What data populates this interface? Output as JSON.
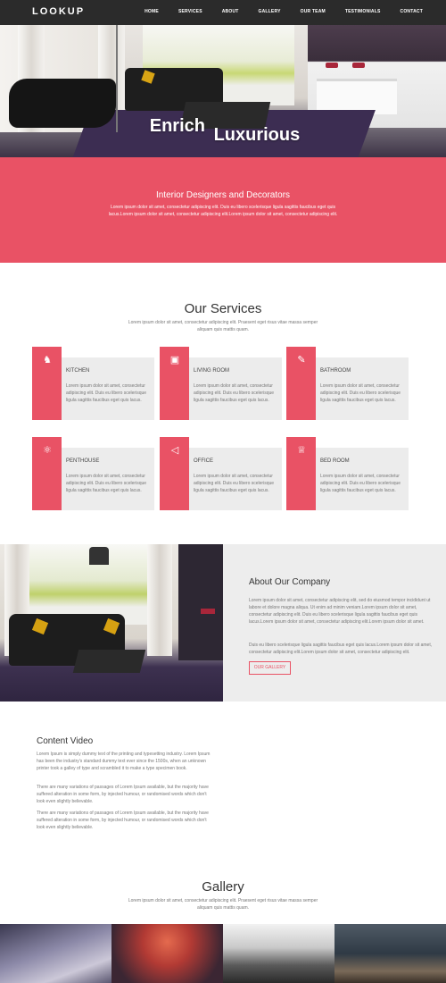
{
  "nav": {
    "logo": "LOOKUP",
    "items": [
      "HOME",
      "SERVICES",
      "ABOUT",
      "GALLERY",
      "OUR TEAM",
      "TESTIMONIALS",
      "CONTACT"
    ]
  },
  "hero": {
    "title_word1": "Enrich",
    "title_word2": "Luxurious"
  },
  "band": {
    "title": "Interior Designers and Decorators",
    "text": "Lorem ipsum dolor sit amet, consectetur adipiscing elit. Duis eu libero scelerisque ligula sagittis faucibus eget quis lacus.Lorem ipsum dolor sit amet, consectetur adipiscing elit.Lorem ipsum dolor sit amet, consectetur adipiscing elit."
  },
  "services": {
    "title": "Our Services",
    "subtitle": "Lorem ipsum dolor sit amet, consectetur adipiscing elit. Praesent eget risus vitae massa semper aliquam quis mattis quam.",
    "cards": [
      {
        "title": "KITCHEN",
        "icon": "chess-knight-icon",
        "glyph": "♞",
        "text": "Lorem ipsum dolor sit amet, consectetur adipiscing elit. Duis eu libero scelerisque ligula sagittis faucibus eget quis lacus."
      },
      {
        "title": "LIVING ROOM",
        "icon": "briefcase-icon",
        "glyph": "▣",
        "text": "Lorem ipsum dolor sit amet, consectetur adipiscing elit. Duis eu libero scelerisque ligula sagittis faucibus eget quis lacus."
      },
      {
        "title": "BATHROOM",
        "icon": "pencil-ruler-icon",
        "glyph": "✎",
        "text": "Lorem ipsum dolor sit amet, consectetur adipiscing elit. Duis eu libero scelerisque ligula sagittis faucibus eget quis lacus."
      },
      {
        "title": "PENTHOUSE",
        "icon": "atom-icon",
        "glyph": "⚛",
        "text": "Lorem ipsum dolor sit amet, consectetur adipiscing elit. Duis eu libero scelerisque ligula sagittis faucibus eget quis lacus."
      },
      {
        "title": "OFFICE",
        "icon": "megaphone-icon",
        "glyph": "◁",
        "text": "Lorem ipsum dolor sit amet, consectetur adipiscing elit. Duis eu libero scelerisque ligula sagittis faucibus eget quis lacus."
      },
      {
        "title": "BED ROOM",
        "icon": "trophy-icon",
        "glyph": "♕",
        "text": "Lorem ipsum dolor sit amet, consectetur adipiscing elit. Duis eu libero scelerisque ligula sagittis faucibus eget quis lacus."
      }
    ]
  },
  "about": {
    "title": "About Our Company",
    "p1": "Lorem ipsum dolor sit amet, consectetur adipiscing elit, sed do eiusmod tempor incididunt ut labore et dolore magna aliqua. Ut enim ad minim veniam.Lorem ipsum dolor sit amet, consectetur adipiscing elit. Duis eu libero scelerisque ligula sagittis faucibus eget quis lacus.Lorem ipsum dolor sit amet, consectetur adipiscing elit.Lorem ipsum dolor sit amet.",
    "p2": "Duis eu libero scelerisque ligula sagittis faucibus eget quis lacus.Lorem ipsum dolor sit amet, consectetur adipiscing elit.Lorem ipsum dolor sit amet, consectetur adipiscing elit.",
    "button": "OUR GALLERY"
  },
  "video": {
    "title": "Content Video",
    "p1": "Lorem Ipsum is simply dummy text of the printing and typesetting industry. Lorem Ipsum has been the industry's standard dummy text ever since the 1500s, when an unknown printer took a galley of type and scrambled it to make a type specimen book.",
    "p2": "There are many variations of passages of Lorem Ipsum available, but the majority have suffered alteration in some form, by injected humour, or randomised words which don't look even slightly believable.",
    "p3": "There are many variations of passages of Lorem Ipsum available, but the majority have suffered alteration in some form, by injected humour, or randomised words which don't look even slightly believable."
  },
  "gallery": {
    "title": "Gallery",
    "subtitle": "Lorem ipsum dolor sit amet, consectetur adipiscing elit. Praesent eget risus vitae massa semper aliquam quis mattis quam."
  },
  "colors": {
    "accent": "#e95265",
    "nav_bg": "#2b2b2b",
    "card_bg": "#ececec"
  }
}
